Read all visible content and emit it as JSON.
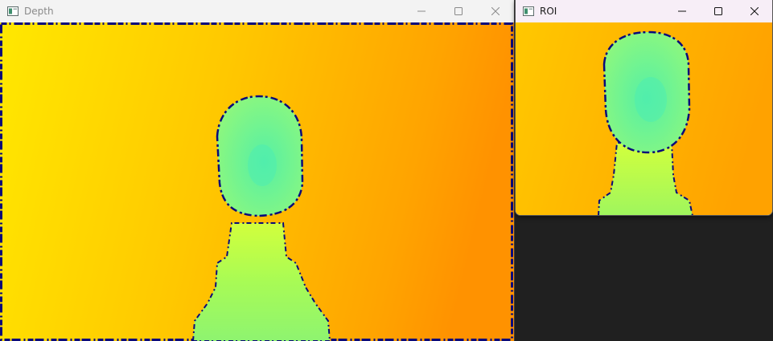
{
  "windows": {
    "depth": {
      "title": "Depth",
      "icon": "opencv-window-icon",
      "controls": [
        "minimize-icon",
        "maximize-icon",
        "close-icon"
      ]
    },
    "roi": {
      "title": "ROI",
      "icon": "opencv-window-icon",
      "controls": [
        "minimize-icon",
        "maximize-icon",
        "close-icon"
      ]
    }
  },
  "colors": {
    "background_near": "#ffe000",
    "background_far": "#ff9800",
    "subject_face": "#6cf59a",
    "subject_neck": "#c9ff45",
    "invalid_depth": "#0a0a7a",
    "desktop": "#202020"
  }
}
